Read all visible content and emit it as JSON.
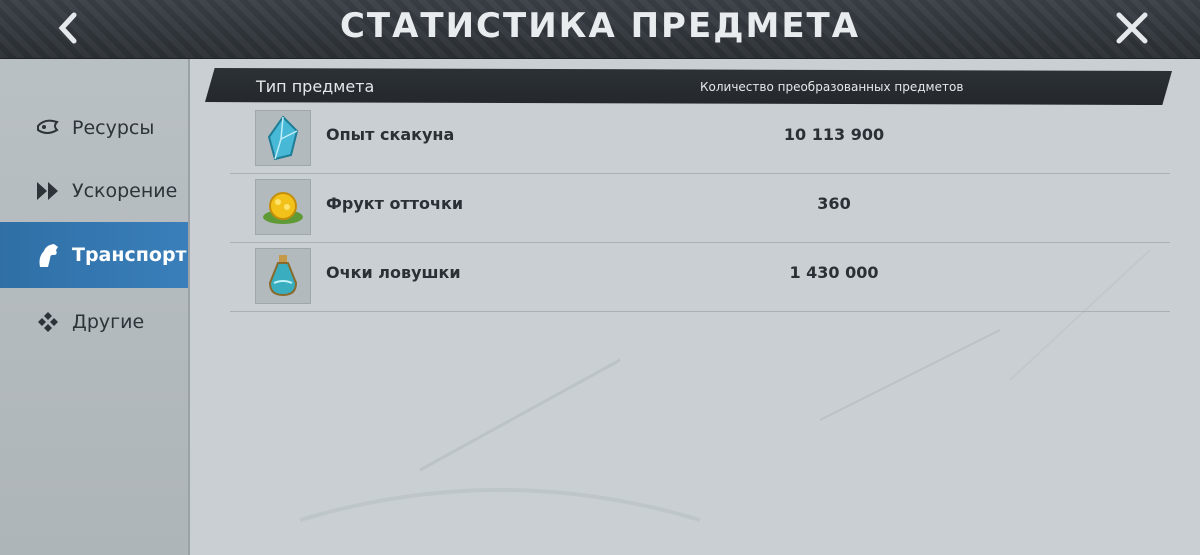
{
  "header": {
    "title": "СТАТИСТИКА ПРЕДМЕТА"
  },
  "sidebar": {
    "items": [
      {
        "label": "Ресурсы",
        "icon": "resources-icon",
        "active": false
      },
      {
        "label": "Ускорение",
        "icon": "speedup-icon",
        "active": false
      },
      {
        "label": "Транспорт",
        "icon": "horse-icon",
        "active": true
      },
      {
        "label": "Другие",
        "icon": "other-icon",
        "active": false
      }
    ]
  },
  "table": {
    "col_type": "Тип предмета",
    "col_count": "Количество преобразованных предметов",
    "rows": [
      {
        "name": "Опыт скакуна",
        "count": "10 113 900",
        "icon": "crystal-icon"
      },
      {
        "name": "Фрукт отточки",
        "count": "360",
        "icon": "fruit-icon"
      },
      {
        "name": "Очки ловушки",
        "count": "1 430 000",
        "icon": "potion-icon"
      }
    ]
  },
  "colors": {
    "active_tab": "#2f6fa6",
    "topbar": "#2b3035",
    "background": "#c9cfd2"
  }
}
